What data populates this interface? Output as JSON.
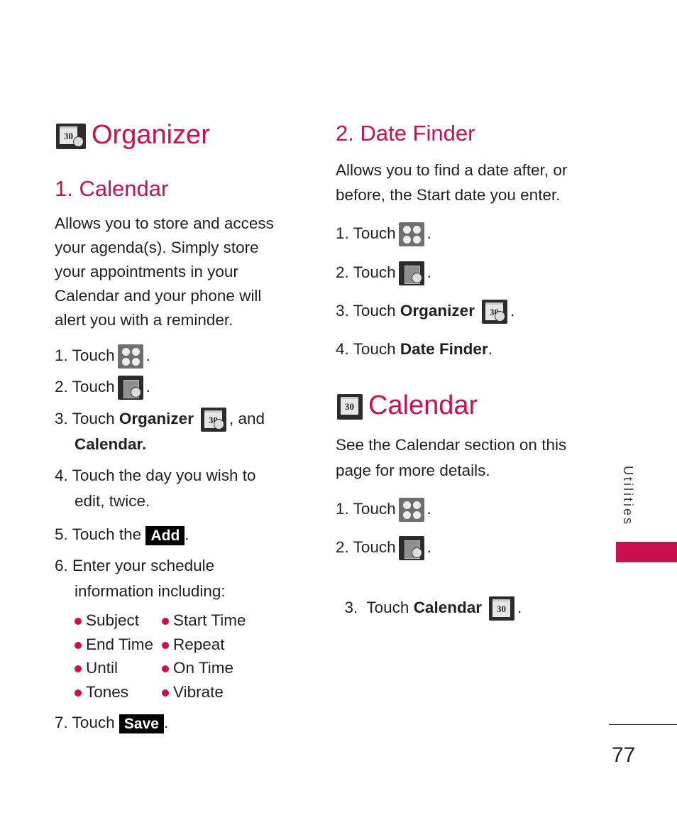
{
  "colors": {
    "accent": "#c8104e",
    "text": "#231f20"
  },
  "left": {
    "title": "Organizer",
    "title_icon": "organizer-calendar-clock-icon",
    "section1": {
      "heading": "1. Calendar",
      "intro": "Allows you to store and access your agenda(s). Simply store your appointments in your Calendar and your phone will alert you with a reminder.",
      "steps": [
        {
          "prefix": "1. Touch",
          "icon": "apps-grid-icon",
          "suffix": "."
        },
        {
          "prefix": "2. Touch",
          "icon": "tools-note-clock-icon",
          "suffix": "."
        },
        {
          "prefix": "3. Touch",
          "bold": "Organizer",
          "icon": "organizer-calendar-clock-icon",
          "suffix": ", and",
          "line2_bold": "Calendar."
        },
        {
          "text": "4. Touch the day you wish to",
          "line2": "edit, twice."
        },
        {
          "prefix": "5. Touch the",
          "button": "Add",
          "suffix": "."
        },
        {
          "text": "6. Enter your schedule",
          "line2": "information including:"
        },
        {
          "prefix": "7. Touch",
          "button": "Save",
          "suffix": "."
        }
      ],
      "bullets": [
        "Subject",
        "Start Time",
        "End Time",
        "Repeat",
        "Until",
        "On Time",
        "Tones",
        "Vibrate"
      ]
    }
  },
  "right": {
    "section2": {
      "heading": "2. Date Finder",
      "intro_l1": "Allows you to find a date after, or",
      "intro_l2": "before, the Start date you enter.",
      "steps": [
        {
          "prefix": "1. Touch",
          "icon": "apps-grid-icon",
          "suffix": "."
        },
        {
          "prefix": "2. Touch",
          "icon": "tools-note-clock-icon",
          "suffix": "."
        },
        {
          "prefix": "3. Touch",
          "bold": "Organizer",
          "icon": "organizer-calendar-clock-icon",
          "suffix": "."
        },
        {
          "prefix": "4. Touch",
          "bold": "Date Finder",
          "suffix": "."
        }
      ]
    },
    "calendar": {
      "title": "Calendar",
      "title_icon": "calendar-30-icon",
      "intro_l1": "See the Calendar section on this",
      "intro_l2": "page for more details.",
      "steps": [
        {
          "prefix": "1. Touch",
          "icon": "apps-grid-icon",
          "suffix": "."
        },
        {
          "prefix": "2. Touch",
          "icon": "tools-note-clock-icon",
          "suffix": "."
        },
        {
          "prefix": "3.  Touch",
          "bold": "Calendar",
          "icon": "calendar-30-icon",
          "suffix": "."
        }
      ]
    }
  },
  "calendar_icon_number": "30",
  "side_tab": "Utilities",
  "page_number": "77"
}
